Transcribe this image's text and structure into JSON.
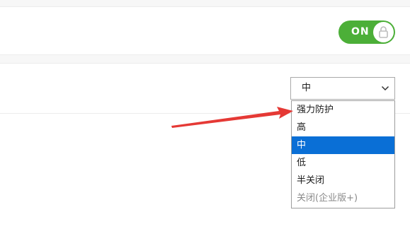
{
  "toggle": {
    "label": "ON",
    "state": "on",
    "knob_icon": "lock-icon",
    "color": "#4caf38"
  },
  "select": {
    "value": "中",
    "chevron_icon": "chevron-down-icon",
    "options": [
      {
        "label": "强力防护",
        "state": "normal"
      },
      {
        "label": "高",
        "state": "normal"
      },
      {
        "label": "中",
        "state": "selected"
      },
      {
        "label": "低",
        "state": "normal"
      },
      {
        "label": "半关闭",
        "state": "normal"
      },
      {
        "label": "关闭(企业版+)",
        "state": "disabled"
      }
    ]
  },
  "annotation": {
    "type": "red-arrow",
    "color": "#e53935",
    "points_to": "option 强力防护"
  },
  "colors": {
    "selected_option_bg": "#0a6fd6",
    "separator_band": "#f7f7f7"
  }
}
